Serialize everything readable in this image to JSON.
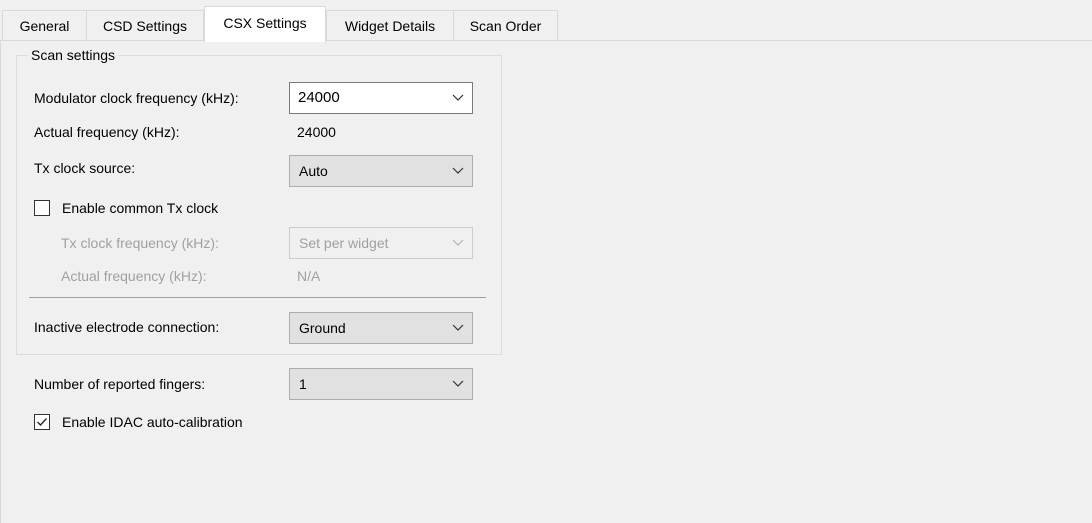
{
  "tabs": [
    {
      "label": "General"
    },
    {
      "label": "CSD Settings"
    },
    {
      "label": "CSX Settings"
    },
    {
      "label": "Widget Details"
    },
    {
      "label": "Scan Order"
    }
  ],
  "scan_settings": {
    "title": "Scan settings",
    "modulator_clock": {
      "label": "Modulator clock frequency (kHz):",
      "value": "24000"
    },
    "actual_frequency": {
      "label": "Actual frequency (kHz):",
      "value": "24000"
    },
    "tx_clock_source": {
      "label": "Tx clock source:",
      "value": "Auto"
    },
    "enable_common_tx": {
      "label": "Enable common Tx clock",
      "checked": false
    },
    "tx_clock_frequency": {
      "label": "Tx clock frequency (kHz):",
      "value": "Set per widget"
    },
    "tx_actual_frequency": {
      "label": "Actual frequency (kHz):",
      "value": "N/A"
    },
    "inactive_electrode": {
      "label": "Inactive electrode connection:",
      "value": "Ground"
    }
  },
  "reported_fingers": {
    "label": "Number of reported fingers:",
    "value": "1"
  },
  "idac_autocal": {
    "label": "Enable IDAC auto-calibration",
    "checked": true
  }
}
